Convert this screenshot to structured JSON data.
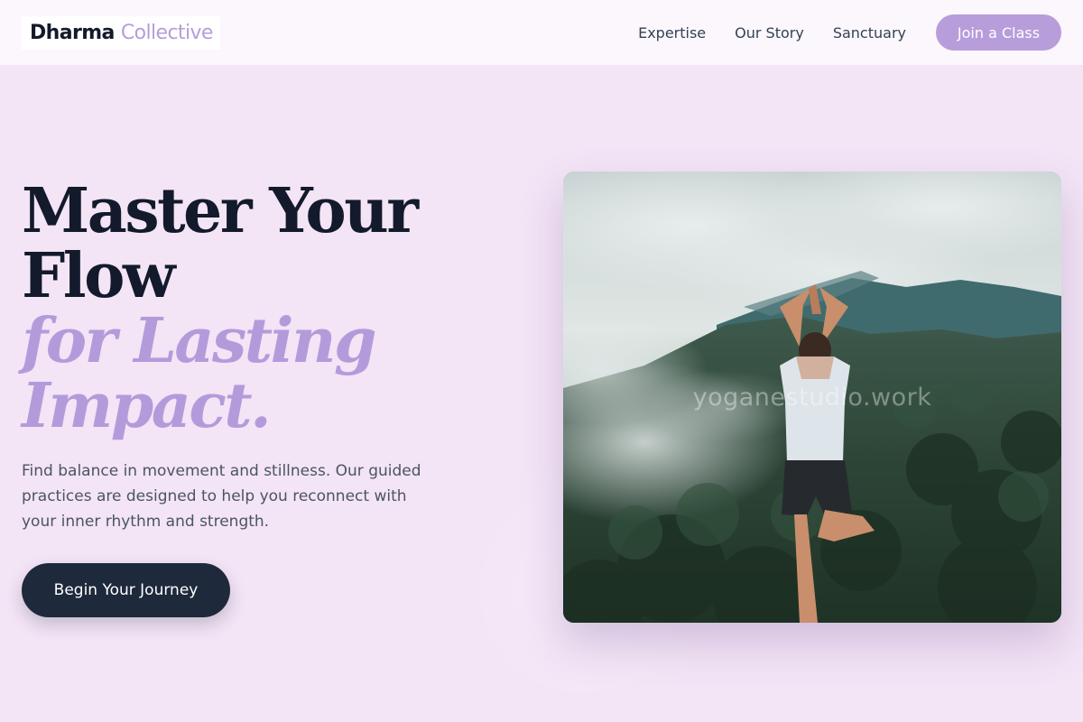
{
  "brand": {
    "name_part1": "Dharma",
    "name_part2": "Collective"
  },
  "nav": {
    "links": [
      "Expertise",
      "Our Story",
      "Sanctuary"
    ],
    "cta_label": "Join a Class"
  },
  "hero": {
    "headline_line1": "Master Your",
    "headline_line2": "Flow",
    "headline_accent_line1": "for Lasting",
    "headline_accent_line2": "Impact.",
    "description": "Find balance in movement and stillness. Our guided practices are designed to help you reconnect with your inner rhythm and strength.",
    "cta_label": "Begin Your Journey",
    "image_watermark": "yoganestudio.work"
  },
  "colors": {
    "background": "#f3e4f6",
    "accent": "#b89ddb",
    "dark": "#1e293b"
  }
}
